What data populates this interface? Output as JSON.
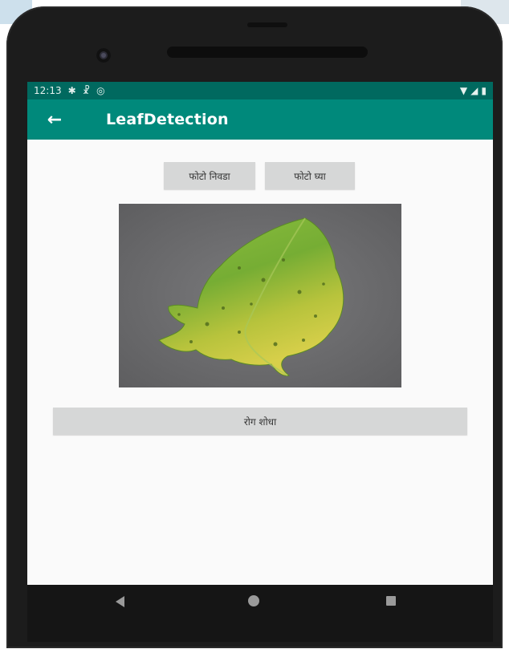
{
  "status_bar": {
    "time": "12:13",
    "left_icons": [
      "settings-icon",
      "accessibility-icon",
      "sync-icon"
    ],
    "right_icons": [
      "wifi-icon",
      "signal-icon",
      "battery-icon"
    ]
  },
  "app_bar": {
    "title": "LeafDetection",
    "back_icon": "arrow-left-icon",
    "color": "#00897b",
    "status_color": "#00695f"
  },
  "buttons": {
    "pick_photo": "फोटो निवडा",
    "take_photo": "फोटो घ्या",
    "detect_disease": "रोग शोधा"
  },
  "image": {
    "content": "leaf-photo"
  },
  "nav_bar": {
    "icons": [
      "nav-back-icon",
      "nav-home-icon",
      "nav-recents-icon"
    ]
  }
}
